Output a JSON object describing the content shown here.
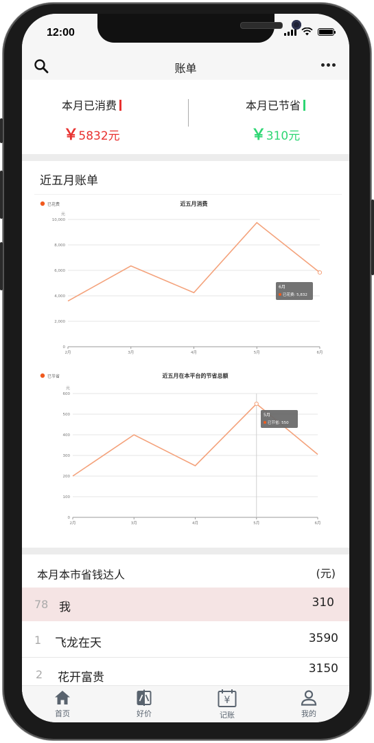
{
  "status": {
    "time": "12:00"
  },
  "nav": {
    "title": "账单",
    "search_icon": "search-icon",
    "more_icon": "more-horizontal-icon"
  },
  "summary": {
    "spent_label": "本月已消费",
    "spent_value": "5832元",
    "spent_currency": "￥",
    "spent_color": "#e8312f",
    "saved_label": "本月已节省",
    "saved_value": "310元",
    "saved_currency": "￥",
    "saved_color": "#2ed673"
  },
  "bills_section": {
    "title": "近五月账单"
  },
  "chart_data": [
    {
      "type": "line",
      "title": "近五月消费",
      "legend": [
        "已花费"
      ],
      "legend_position": "top-left",
      "ylabel": "元",
      "categories": [
        "2月",
        "3月",
        "4月",
        "5月",
        "6月"
      ],
      "series": [
        {
          "name": "已花费",
          "values": [
            3590,
            6350,
            4250,
            9750,
            5832
          ]
        }
      ],
      "ylim": [
        0,
        10000
      ],
      "yticks": [
        "0",
        "2,000",
        "4,000",
        "6,000",
        "8,000",
        "10,000"
      ],
      "tooltip": {
        "title": "6月",
        "text": "已花费: 5,832"
      },
      "grid": true,
      "color": "#f4a27b"
    },
    {
      "type": "line",
      "title": "近五月在本平台的节省总额",
      "legend": [
        "已节省"
      ],
      "legend_position": "top-left",
      "ylabel": "元",
      "categories": [
        "2月",
        "3月",
        "4月",
        "5月",
        "6月"
      ],
      "series": [
        {
          "name": "已节省",
          "values": [
            200,
            400,
            250,
            550,
            305
          ]
        }
      ],
      "ylim": [
        0,
        600
      ],
      "yticks": [
        "0",
        "100",
        "200",
        "300",
        "400",
        "500",
        "600"
      ],
      "tooltip": {
        "title": "5月",
        "text": "已节省: 550"
      },
      "grid": true,
      "color": "#f4a27b"
    }
  ],
  "ranking": {
    "title": "本月本市省钱达人",
    "unit": "(元)",
    "rows": [
      {
        "rank": "78",
        "name": "我",
        "value": "310"
      },
      {
        "rank": "1",
        "name": "飞龙在天",
        "value": "3590"
      },
      {
        "rank": "2",
        "name": "花开富贵",
        "value": "3150"
      }
    ]
  },
  "tabs": [
    {
      "label": "首页",
      "icon": "home-icon"
    },
    {
      "label": "好价",
      "icon": "compare-icon"
    },
    {
      "label": "记账",
      "icon": "calendar-yen-icon"
    },
    {
      "label": "我的",
      "icon": "user-icon"
    }
  ]
}
